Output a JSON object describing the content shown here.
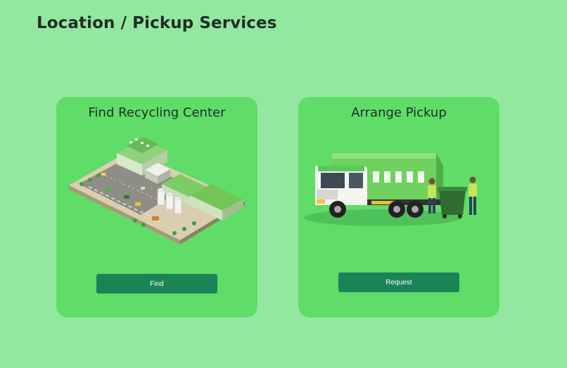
{
  "page": {
    "title": "Location / Pickup Services",
    "background_color": "#93e89f"
  },
  "cards": [
    {
      "title": "Find Recycling Center",
      "illustration": "recycling-facility-isometric",
      "button_label": "Find"
    },
    {
      "title": "Arrange Pickup",
      "illustration": "garbage-truck-with-workers",
      "button_label": "Request"
    }
  ],
  "colors": {
    "card": "#5fdd68",
    "button": "#1b8456",
    "button_text": "#ffffff",
    "text": "#1f2d27"
  }
}
